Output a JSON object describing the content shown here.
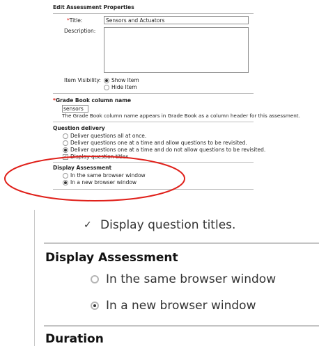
{
  "edit_properties": {
    "section_title": "Edit Assessment Properties",
    "title_required_marker": "*",
    "title_label": "Title:",
    "title_value": "Sensors and Actuators",
    "description_label": "Description:",
    "description_value": "",
    "item_visibility_label": "Item Visibility:",
    "visibility_options": [
      {
        "label": "Show Item",
        "selected": true
      },
      {
        "label": "Hide Item",
        "selected": false
      }
    ]
  },
  "gradebook": {
    "required_marker": "*",
    "heading": "Grade Book column name",
    "value": "sensors",
    "help_text": "The Grade Book column name appears in Grade Book as a column header for this assessment."
  },
  "question_delivery": {
    "heading": "Question delivery",
    "options": [
      {
        "label": "Deliver questions all at once.",
        "selected": false
      },
      {
        "label": "Deliver questions one at a time and allow questions to be revisited.",
        "selected": false
      },
      {
        "label": "Deliver questions one at a time and do not allow questions to be revisited.",
        "selected": true
      }
    ],
    "display_titles_label": "Display question titles.",
    "display_titles_checked": true
  },
  "display_assessment": {
    "heading": "Display Assessment",
    "options": [
      {
        "label": "In the same browser window",
        "selected": false
      },
      {
        "label": "In a new browser window",
        "selected": true
      }
    ]
  },
  "zoomed": {
    "display_titles_label": "Display question titles.",
    "heading": "Display Assessment",
    "option_same": "In the same browser window",
    "option_new": "In a new browser window",
    "duration_heading": "Duration"
  },
  "colors": {
    "required": "#e0201a",
    "highlight_ellipse": "#e0201a"
  }
}
